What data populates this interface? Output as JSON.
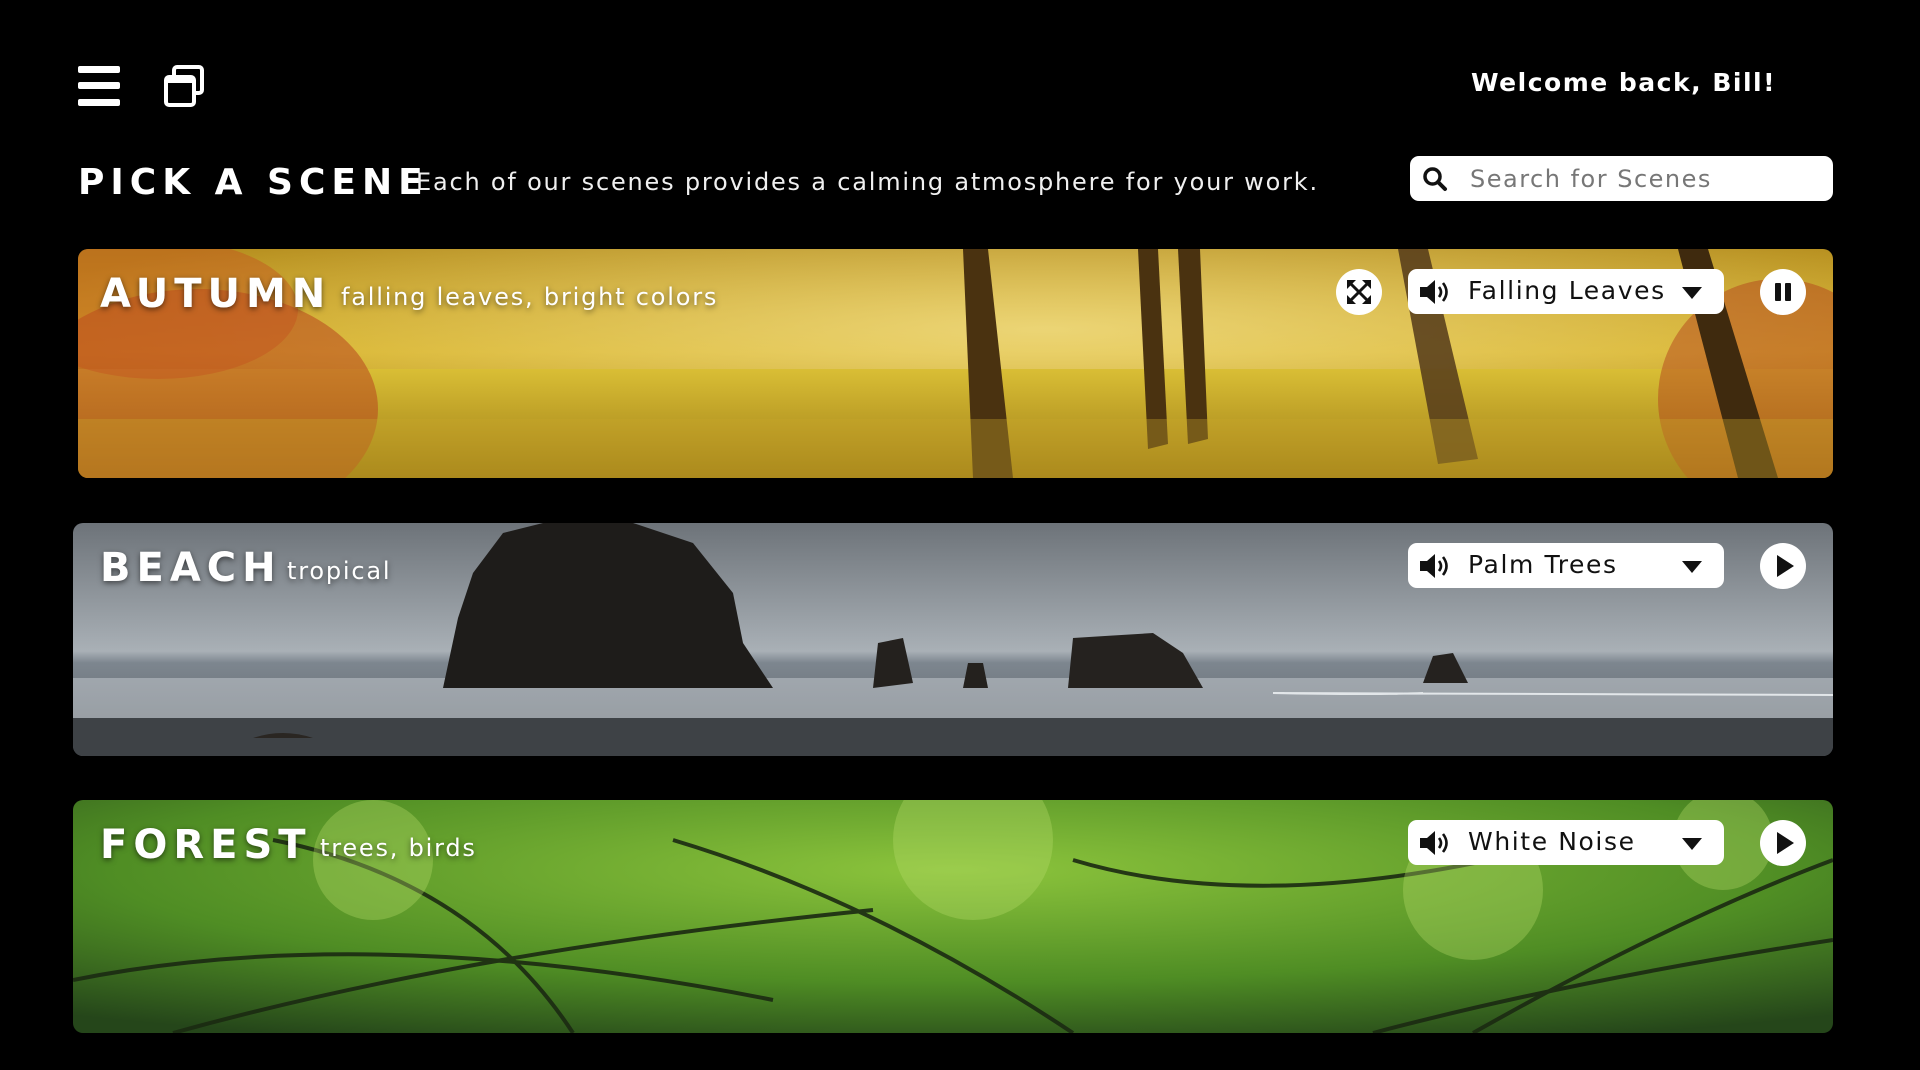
{
  "header": {
    "welcome": "Welcome back, Bill!",
    "menu_icon": "hamburger-menu-icon",
    "windows_icon": "windows-stack-icon"
  },
  "page": {
    "title": "PICK A SCENE",
    "subtitle": "Each of our scenes provides a calming atmosphere for your work."
  },
  "search": {
    "placeholder": "Search for Scenes",
    "value": "",
    "icon": "search-icon"
  },
  "scenes": [
    {
      "title": "AUTUMN",
      "subtitle": "falling leaves, bright colors",
      "sound": "Falling Leaves",
      "state": "playing",
      "has_fullscreen": true,
      "colors": [
        "#7a5a10",
        "#c9a31a",
        "#e8c435",
        "#a06f1a"
      ]
    },
    {
      "title": "BEACH",
      "subtitle": "tropical",
      "sound": "Palm Trees",
      "state": "paused",
      "has_fullscreen": false,
      "colors": [
        "#4a5158",
        "#9aa3ad",
        "#b9c0c6",
        "#6c7278"
      ]
    },
    {
      "title": "FOREST",
      "subtitle": "trees, birds",
      "sound": "White Noise",
      "state": "paused",
      "has_fullscreen": false,
      "colors": [
        "#1d3a12",
        "#3f7a1f",
        "#6ea52e",
        "#2a4d17"
      ]
    }
  ],
  "icons": {
    "speaker": "speaker-volume-icon",
    "dropdown": "caret-down-icon",
    "play": "play-icon",
    "pause": "pause-icon",
    "fullscreen": "fullscreen-expand-icon"
  }
}
